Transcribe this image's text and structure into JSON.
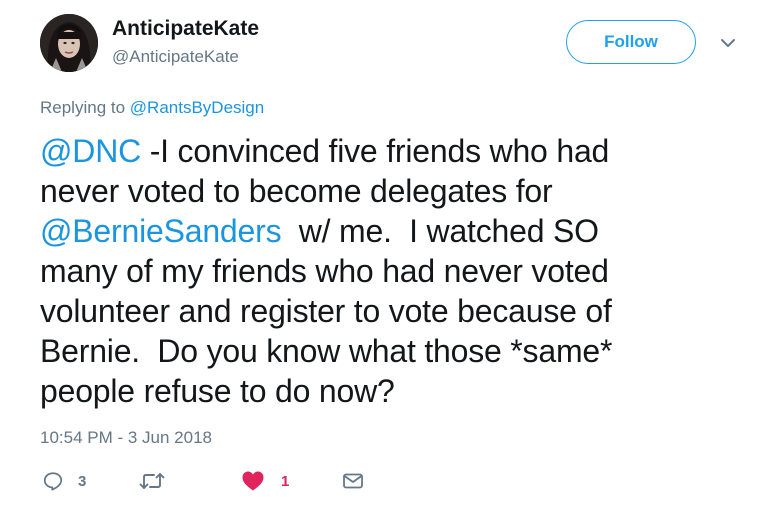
{
  "author": {
    "display_name": "AnticipateKate",
    "handle": "@AnticipateKate"
  },
  "header": {
    "follow_label": "Follow",
    "caret_icon": "chevron-down-icon"
  },
  "reply_context": {
    "prefix": "Replying to ",
    "mention": "@RantsByDesign"
  },
  "tweet": {
    "line1_mention": "@DNC",
    "line1_text": " -I convinced five friends who had",
    "line2_text": "never voted to become delegates for",
    "line3_mention": "@BernieSanders",
    "line3_text": "  w/ me.  I watched SO",
    "line4_text": "many of my friends who had never voted",
    "line5_text": "volunteer and register to vote because of",
    "line6_text": "Bernie.  Do you know what those *same*",
    "line7_text": "people refuse to do now?"
  },
  "timestamp": "10:54 PM - 3 Jun 2018",
  "actions": {
    "reply_icon": "reply-icon",
    "reply_count": "3",
    "retweet_icon": "retweet-icon",
    "like_icon": "heart-icon",
    "like_count": "1",
    "dm_icon": "envelope-icon"
  },
  "colors": {
    "link": "#1b95e0",
    "follow": "#1da1f2",
    "muted": "#657786",
    "like": "#e0245e",
    "text": "#14171a"
  }
}
